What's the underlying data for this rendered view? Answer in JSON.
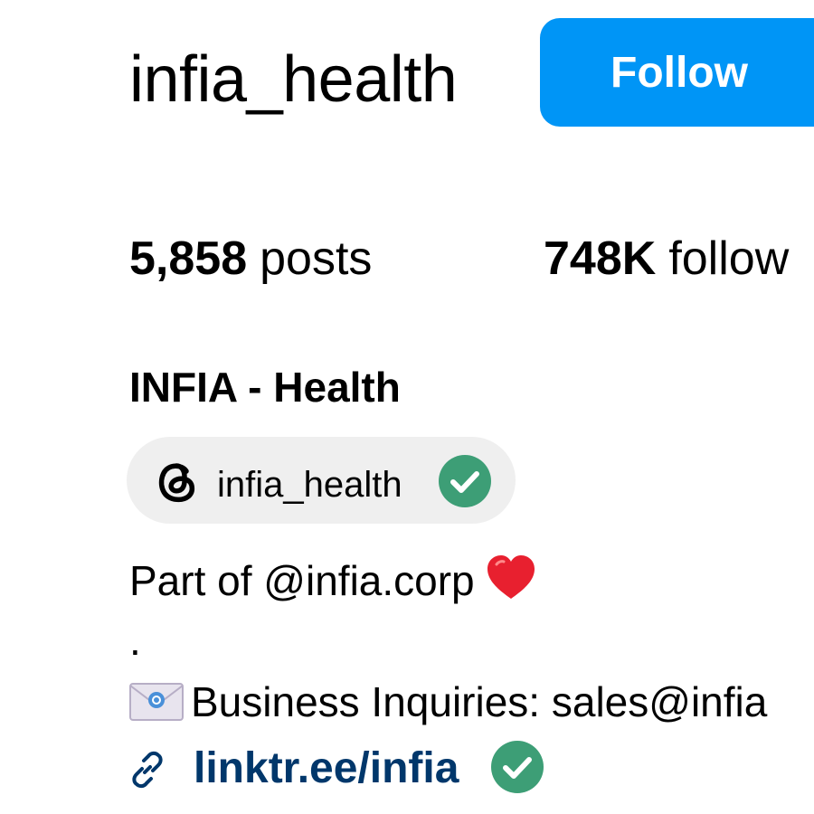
{
  "profile": {
    "username": "infia_health",
    "follow_label": "Follow",
    "full_name": "INFIA - Health"
  },
  "stats": {
    "posts_count": "5,858",
    "posts_label": "posts",
    "followers_count": "748K",
    "followers_label": "follow"
  },
  "threads": {
    "handle": "infia_health",
    "icon": "threads-icon",
    "verified_icon": "verified-badge-icon"
  },
  "bio": {
    "line1": "Part of @infia.corp",
    "line1_icon": "heart-icon",
    "line2_dot": ".",
    "line3_icon": "envelope-icon",
    "line3": "Business Inquiries: sales@infia"
  },
  "link": {
    "icon": "link-icon",
    "text": "linktr.ee/infia",
    "verified_icon": "verified-badge-icon"
  },
  "colors": {
    "follow_button": "#0095f6",
    "verified_badge": "#3d9e76",
    "threads_pill": "#efefef",
    "link_text": "#00376b",
    "heart": "#e8202f"
  }
}
